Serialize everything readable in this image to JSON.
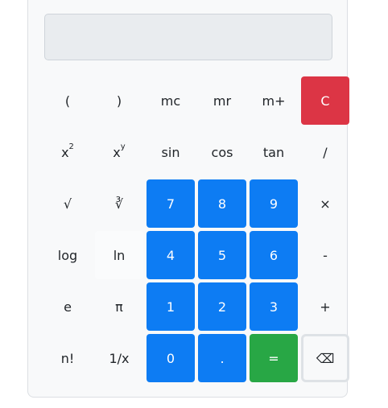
{
  "display": {
    "value": ""
  },
  "keys": [
    {
      "label": "(",
      "name": "open-paren-button",
      "cls": ""
    },
    {
      "label": ")",
      "name": "close-paren-button",
      "cls": ""
    },
    {
      "label": "mc",
      "name": "memory-clear-button",
      "cls": ""
    },
    {
      "label": "mr",
      "name": "memory-recall-button",
      "cls": ""
    },
    {
      "label": "m+",
      "name": "memory-add-button",
      "cls": ""
    },
    {
      "label": "C",
      "name": "clear-button",
      "cls": "k-clear"
    },
    {
      "label": "x²",
      "name": "square-button",
      "cls": "",
      "base": "x",
      "sup": "2"
    },
    {
      "label": "xʸ",
      "name": "power-button",
      "cls": "",
      "base": "x",
      "sup": "y"
    },
    {
      "label": "sin",
      "name": "sin-button",
      "cls": ""
    },
    {
      "label": "cos",
      "name": "cos-button",
      "cls": ""
    },
    {
      "label": "tan",
      "name": "tan-button",
      "cls": ""
    },
    {
      "label": "/",
      "name": "divide-button",
      "cls": ""
    },
    {
      "label": "√",
      "name": "sqrt-button",
      "cls": ""
    },
    {
      "label": "∛",
      "name": "cbrt-button",
      "cls": ""
    },
    {
      "label": "7",
      "name": "digit-7-button",
      "cls": "k-num"
    },
    {
      "label": "8",
      "name": "digit-8-button",
      "cls": "k-num"
    },
    {
      "label": "9",
      "name": "digit-9-button",
      "cls": "k-num"
    },
    {
      "label": "×",
      "name": "multiply-button",
      "cls": ""
    },
    {
      "label": "log",
      "name": "log-button",
      "cls": ""
    },
    {
      "label": "ln",
      "name": "ln-button",
      "cls": "k-ln"
    },
    {
      "label": "4",
      "name": "digit-4-button",
      "cls": "k-num"
    },
    {
      "label": "5",
      "name": "digit-5-button",
      "cls": "k-num"
    },
    {
      "label": "6",
      "name": "digit-6-button",
      "cls": "k-num"
    },
    {
      "label": "-",
      "name": "subtract-button",
      "cls": ""
    },
    {
      "label": "e",
      "name": "euler-button",
      "cls": ""
    },
    {
      "label": "π",
      "name": "pi-button",
      "cls": ""
    },
    {
      "label": "1",
      "name": "digit-1-button",
      "cls": "k-num"
    },
    {
      "label": "2",
      "name": "digit-2-button",
      "cls": "k-num"
    },
    {
      "label": "3",
      "name": "digit-3-button",
      "cls": "k-num"
    },
    {
      "label": "+",
      "name": "add-button",
      "cls": ""
    },
    {
      "label": "n!",
      "name": "factorial-button",
      "cls": ""
    },
    {
      "label": "1/x",
      "name": "reciprocal-button",
      "cls": ""
    },
    {
      "label": "0",
      "name": "digit-0-button",
      "cls": "k-num"
    },
    {
      "label": ".",
      "name": "decimal-button",
      "cls": "k-num"
    },
    {
      "label": "=",
      "name": "equals-button",
      "cls": "k-equal"
    },
    {
      "label": "⌫",
      "name": "backspace-button",
      "cls": "k-back"
    }
  ],
  "colors": {
    "digit": "#0d7cf3",
    "clear": "#dc3545",
    "equals": "#28a745"
  }
}
